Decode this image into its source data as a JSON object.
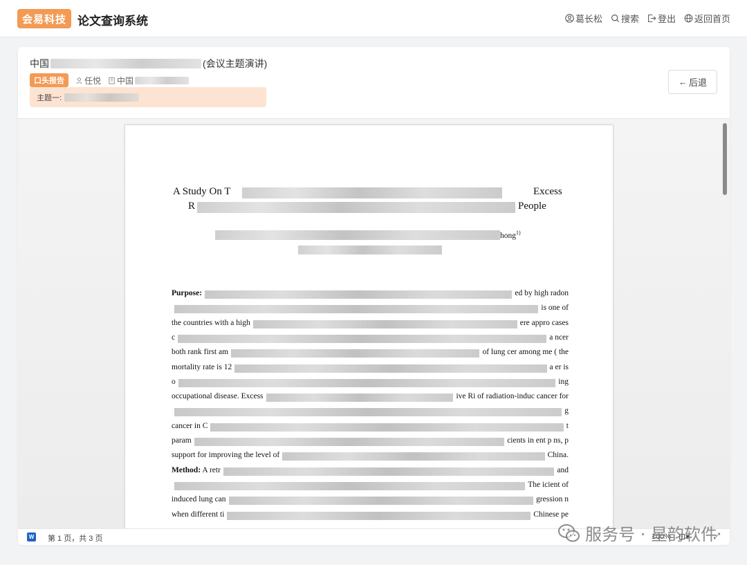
{
  "header": {
    "logo": "会易科技",
    "app_title": "论文查询系统",
    "nav": [
      {
        "label": "葛长松",
        "icon": "user-icon"
      },
      {
        "label": "搜索",
        "icon": "search-icon"
      },
      {
        "label": "登出",
        "icon": "logout-icon"
      },
      {
        "label": "返回首页",
        "icon": "globe-icon"
      }
    ]
  },
  "paper": {
    "title_prefix": "中国",
    "title_suffix": "(会议主题演讲)",
    "tag": "口头报告",
    "author": "任悦",
    "org_prefix": "中国",
    "topic_label": "主题一:",
    "back_label": "后退"
  },
  "document": {
    "title_line1_start": "A Study On T",
    "title_line1_end": "Excess",
    "title_line2_start": "R",
    "title_line2_end": "People",
    "authors_end": "hong",
    "authors_sup": "1)",
    "lines": [
      {
        "left": "Purpose:",
        "left_bold": true,
        "right": "ed by high radon"
      },
      {
        "left": "",
        "right": "is  one of"
      },
      {
        "left": "the countries with a high",
        "right": "ere appro         cases"
      },
      {
        "left": "c",
        "right": "a                    ncer"
      },
      {
        "left": "both rank first am",
        "right": "of lung  cer among me             (  the"
      },
      {
        "left": "mortality rate is 12",
        "right": "a  er is"
      },
      {
        "left": "o",
        "right": "ing"
      },
      {
        "left": "occupational disease. Excess",
        "right": "ive  Ri       of radiation-induc  cancer           for"
      },
      {
        "left": "",
        "right": "g"
      },
      {
        "left": "cancer  in  C",
        "right": "t"
      },
      {
        "left": "param",
        "right": "cients in       ent p         ns,  p"
      },
      {
        "left": "support for improving the level of",
        "right": "China."
      },
      {
        "left": "Method:",
        "left_bold": true,
        "left_extra": " A retr",
        "right": "and"
      },
      {
        "left": "",
        "right": "The        icient of"
      },
      {
        "left": "induced lung can",
        "right": "gression  n"
      },
      {
        "left": "when different ti",
        "right": "Chinese pe"
      }
    ]
  },
  "footer": {
    "page_info": "第 1 页，共 3 页",
    "zoom": "100%",
    "watermark": "服务号 · 星韵软件"
  }
}
